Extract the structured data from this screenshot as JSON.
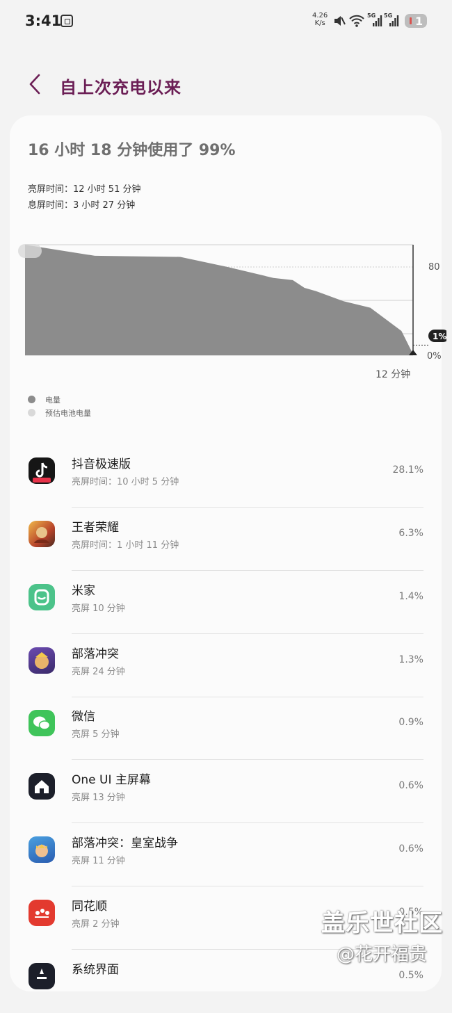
{
  "status_bar": {
    "time": "3:41",
    "speed_value": "4.26",
    "speed_unit": "K/s",
    "net1": "5G",
    "net2": "5G",
    "battery_level": "1"
  },
  "header": {
    "title": "自上次充电以来"
  },
  "summary": {
    "usage": "16 小时 18 分钟使用了 99%",
    "screen_on": "亮屏时间：12 小时 51 分钟",
    "screen_off": "息屏时间：3 小时 27 分钟"
  },
  "chart_data": {
    "type": "area",
    "x": [
      0,
      0.036,
      0.18,
      0.4,
      0.52,
      0.64,
      0.69,
      0.72,
      0.75,
      0.82,
      0.89,
      0.97,
      1.0
    ],
    "values": [
      100,
      98,
      90,
      89,
      80,
      70,
      68,
      61,
      58,
      49,
      43,
      22,
      1
    ],
    "ylim": [
      0,
      100
    ],
    "y_ticks": [
      "80",
      "0%"
    ],
    "x_tick_label": "12 分钟",
    "current_label": "1%",
    "colors": {
      "fill": "#8c8c8c",
      "estimated": "#d9d9d9",
      "grid": "#cfcfcf"
    }
  },
  "legend": [
    {
      "label": "电量",
      "color": "#8c8c8c"
    },
    {
      "label": "预估电池电量",
      "color": "#d9d9d9"
    }
  ],
  "apps": [
    {
      "name": "抖音极速版",
      "sub": "亮屏时间：10 小时 5 分钟",
      "pct": "28.1%",
      "icon": "douyin-lite-icon"
    },
    {
      "name": "王者荣耀",
      "sub": "亮屏时间：1 小时 11 分钟",
      "pct": "6.3%",
      "icon": "honor-of-kings-icon"
    },
    {
      "name": "米家",
      "sub": "亮屏 10 分钟",
      "pct": "1.4%",
      "icon": "mijia-icon"
    },
    {
      "name": "部落冲突",
      "sub": "亮屏 24 分钟",
      "pct": "1.3%",
      "icon": "clash-of-clans-icon"
    },
    {
      "name": "微信",
      "sub": "亮屏 5 分钟",
      "pct": "0.9%",
      "icon": "wechat-icon"
    },
    {
      "name": "One UI 主屏幕",
      "sub": "亮屏 13 分钟",
      "pct": "0.6%",
      "icon": "one-ui-home-icon"
    },
    {
      "name": "部落冲突：皇室战争",
      "sub": "亮屏 11 分钟",
      "pct": "0.6%",
      "icon": "clash-royale-icon"
    },
    {
      "name": "同花顺",
      "sub": "亮屏 2 分钟",
      "pct": "0.5%",
      "icon": "tonghuashun-icon"
    },
    {
      "name": "系统界面",
      "sub": "",
      "pct": "0.5%",
      "icon": "system-ui-icon"
    }
  ],
  "watermark": {
    "line1": "盖乐世社区",
    "line2": "@花开福贵"
  }
}
